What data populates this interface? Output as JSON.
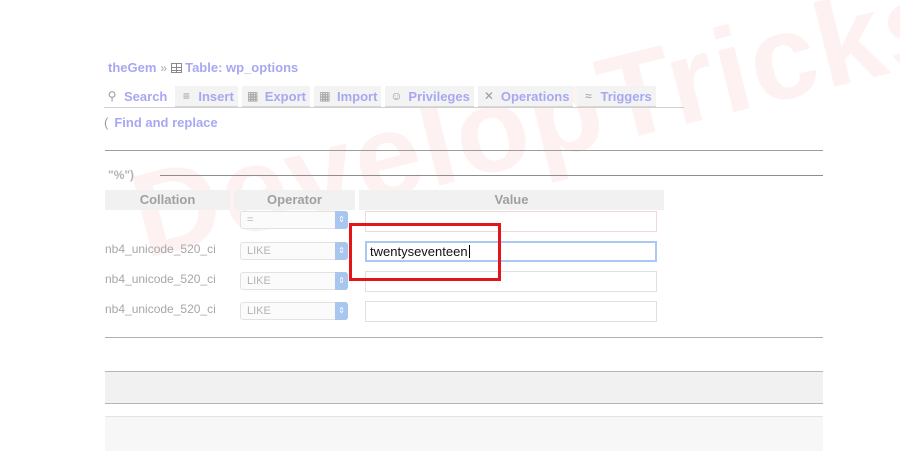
{
  "breadcrumb": {
    "db": "theGem",
    "separator": "»",
    "table_label": "Table: wp_options"
  },
  "tabs": [
    {
      "id": "search",
      "label": "Search",
      "icon": "search-icon",
      "active": true
    },
    {
      "id": "insert",
      "label": "Insert",
      "icon": "insert-icon"
    },
    {
      "id": "export",
      "label": "Export",
      "icon": "export-icon"
    },
    {
      "id": "import",
      "label": "Import",
      "icon": "import-icon"
    },
    {
      "id": "privileges",
      "label": "Privileges",
      "icon": "privileges-icon"
    },
    {
      "id": "operations",
      "label": "Operations",
      "icon": "operations-icon"
    },
    {
      "id": "triggers",
      "label": "Triggers",
      "icon": "triggers-icon"
    }
  ],
  "find_replace": "Find and replace",
  "fieldset_legend": "\"%\")",
  "columns": {
    "collation": "Collation",
    "operator": "Operator",
    "value": "Value"
  },
  "rows": [
    {
      "collation": "",
      "operator": "=",
      "value": ""
    },
    {
      "collation": "nb4_unicode_520_ci",
      "operator": "LIKE",
      "value": "twentyseventeen"
    },
    {
      "collation": "nb4_unicode_520_ci",
      "operator": "LIKE",
      "value": ""
    },
    {
      "collation": "nb4_unicode_520_ci",
      "operator": "LIKE",
      "value": ""
    }
  ],
  "watermark": "DevelopTricks",
  "colors": {
    "link": "#a7a8f3",
    "highlight": "#e4141b",
    "focus_border": "#a9c8f3"
  }
}
